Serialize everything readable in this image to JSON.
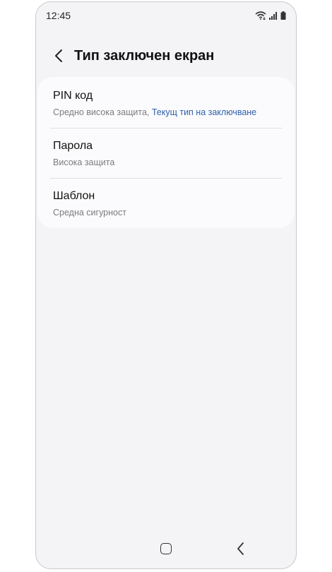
{
  "status_bar": {
    "time": "12:45",
    "icons": [
      "wifi-icon",
      "signal-icon",
      "battery-icon"
    ]
  },
  "header": {
    "back_icon": "chevron-left-icon",
    "title": "Тип заключен екран"
  },
  "options": [
    {
      "title": "PIN код",
      "subtitle": "Средно висока защита, ",
      "subtitle_accent": "Текущ тип на заключване"
    },
    {
      "title": "Парола",
      "subtitle": "Висока защита"
    },
    {
      "title": "Шаблон",
      "subtitle": "Средна сигурност"
    }
  ],
  "nav_bar": {
    "icons": [
      "home-icon",
      "back-icon"
    ]
  },
  "colors": {
    "background": "#f4f4f7",
    "card": "#fbfbfd",
    "accent": "#2f5fa8",
    "secondary_text": "#7b7b7f"
  }
}
